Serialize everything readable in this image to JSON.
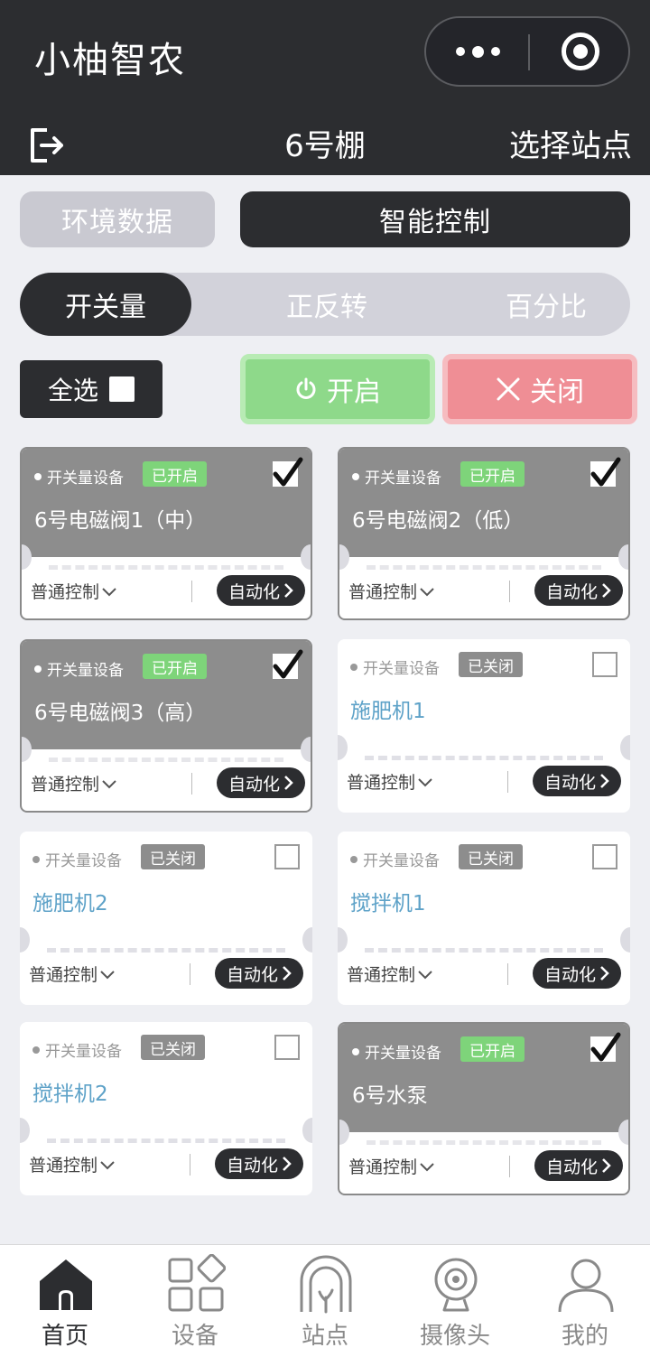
{
  "header": {
    "app_title": "小柚智农",
    "station_name": "6号棚",
    "select_station": "选择站点"
  },
  "tabs": {
    "env": "环境数据",
    "smart": "智能控制"
  },
  "segments": [
    "开关量",
    "正反转",
    "百分比"
  ],
  "actions": {
    "select_all": "全选",
    "open": "开启",
    "close": "关闭"
  },
  "colors": {
    "dark": "#2c2d30",
    "open_green": "#8ed98a",
    "close_red": "#ef8e95",
    "device_name_blue": "#5ea2c8",
    "on_card_gray": "#8d8d8d"
  },
  "devices": [
    {
      "type": "开关量设备",
      "status": "已开启",
      "name": "6号电磁阀1（中）",
      "checked": true,
      "control": "普通控制",
      "auto": "自动化"
    },
    {
      "type": "开关量设备",
      "status": "已开启",
      "name": "6号电磁阀2（低）",
      "checked": true,
      "control": "普通控制",
      "auto": "自动化"
    },
    {
      "type": "开关量设备",
      "status": "已开启",
      "name": "6号电磁阀3（高）",
      "checked": true,
      "control": "普通控制",
      "auto": "自动化"
    },
    {
      "type": "开关量设备",
      "status": "已关闭",
      "name": "施肥机1",
      "checked": false,
      "control": "普通控制",
      "auto": "自动化"
    },
    {
      "type": "开关量设备",
      "status": "已关闭",
      "name": "施肥机2",
      "checked": false,
      "control": "普通控制",
      "auto": "自动化"
    },
    {
      "type": "开关量设备",
      "status": "已关闭",
      "name": "搅拌机1",
      "checked": false,
      "control": "普通控制",
      "auto": "自动化"
    },
    {
      "type": "开关量设备",
      "status": "已关闭",
      "name": "搅拌机2",
      "checked": false,
      "control": "普通控制",
      "auto": "自动化"
    },
    {
      "type": "开关量设备",
      "status": "已开启",
      "name": "6号水泵",
      "checked": true,
      "control": "普通控制",
      "auto": "自动化"
    }
  ],
  "bottom_nav": [
    {
      "label": "首页",
      "icon": "home-icon"
    },
    {
      "label": "设备",
      "icon": "grid-icon"
    },
    {
      "label": "站点",
      "icon": "greenhouse-icon"
    },
    {
      "label": "摄像头",
      "icon": "camera-icon"
    },
    {
      "label": "我的",
      "icon": "user-icon"
    }
  ]
}
